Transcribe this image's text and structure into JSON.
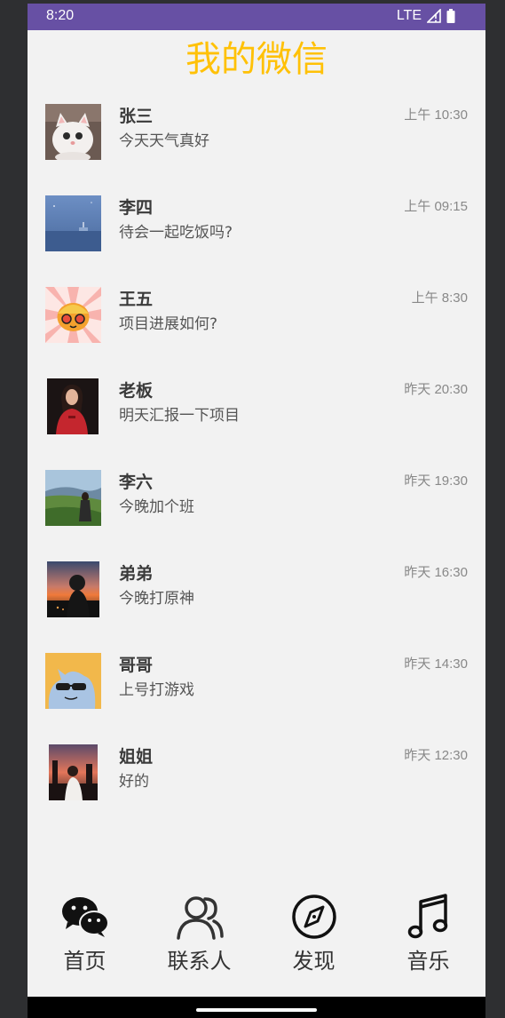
{
  "status_bar": {
    "time": "8:20",
    "network": "LTE",
    "signal_icon": "signal-icon",
    "battery_icon": "battery-icon",
    "background": "#6750a4"
  },
  "app": {
    "title": "我的微信",
    "title_color": "#ffc107"
  },
  "chats": [
    {
      "name": "张三",
      "message": "今天天气真好",
      "time": "上午 10:30",
      "avatar": "white-cat"
    },
    {
      "name": "李四",
      "message": "待会一起吃饭吗?",
      "time": "上午 09:15",
      "avatar": "blue-sky"
    },
    {
      "name": "王五",
      "message": "项目进展如何?",
      "time": "上午 8:30",
      "avatar": "cartoon-face"
    },
    {
      "name": "老板",
      "message": "明天汇报一下项目",
      "time": "昨天 20:30",
      "avatar": "woman-in-red"
    },
    {
      "name": "李六",
      "message": "今晚加个班",
      "time": "昨天 19:30",
      "avatar": "green-landscape"
    },
    {
      "name": "弟弟",
      "message": "今晚打原神",
      "time": "昨天 16:30",
      "avatar": "sunset-rider"
    },
    {
      "name": "哥哥",
      "message": "上号打游戏",
      "time": "昨天 14:30",
      "avatar": "cool-cartoon"
    },
    {
      "name": "姐姐",
      "message": "好的",
      "time": "昨天 12:30",
      "avatar": "sunset-girl"
    }
  ],
  "bottom_nav": [
    {
      "label": "首页",
      "icon": "wechat-icon"
    },
    {
      "label": "联系人",
      "icon": "contacts-icon"
    },
    {
      "label": "发现",
      "icon": "compass-icon"
    },
    {
      "label": "音乐",
      "icon": "music-note-icon"
    }
  ]
}
